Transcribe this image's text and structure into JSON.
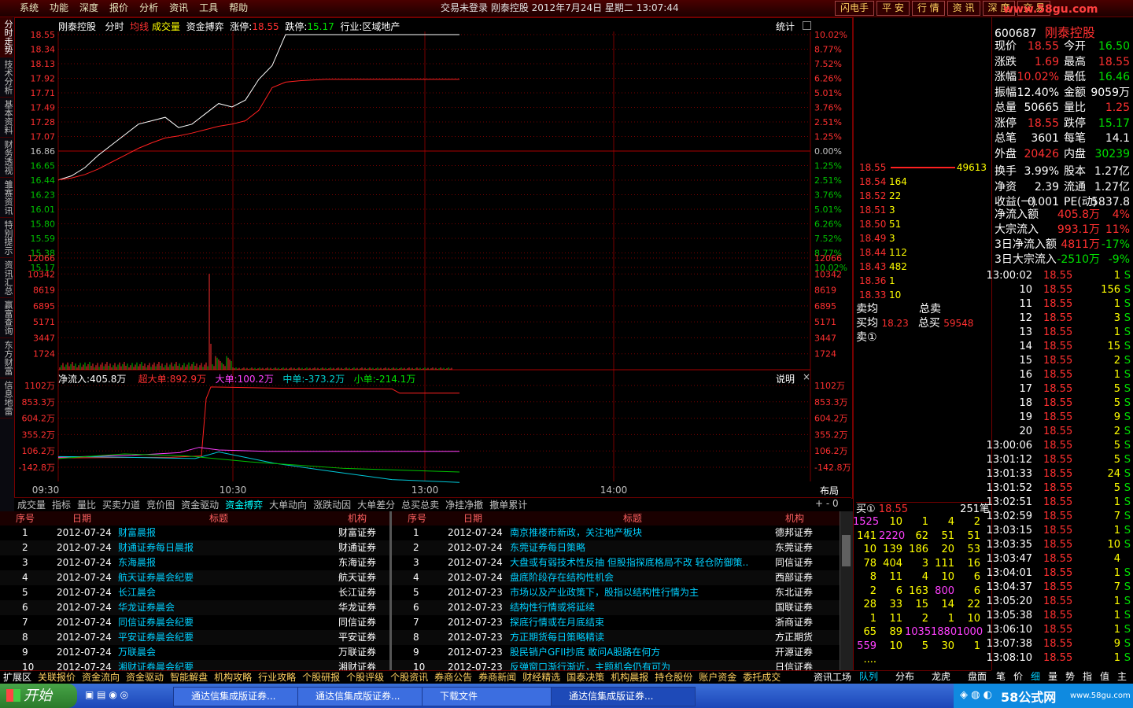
{
  "menu": {
    "items": [
      "系统",
      "功能",
      "深度",
      "报价",
      "分析",
      "资讯",
      "工具",
      "帮助"
    ]
  },
  "window_title": "交易未登录   刚泰控股  2012年7月24日  星期二  13:07:44",
  "top_buttons": [
    "闪电手",
    "平 安",
    "行 情",
    "资 讯",
    "深 度",
    "交 易"
  ],
  "watermark": "www.58gu.com",
  "side_tabs": [
    "分时走势",
    "技术分析",
    "基本资料",
    "财务透视",
    "雏赛资讯",
    "特别提示",
    "资讯汇总",
    "赢富查询",
    "东方财富",
    "信息地雷"
  ],
  "chart_header": {
    "name": "刚泰控股",
    "mode": "分时",
    "avg_label": "均线",
    "vol_label": "成交量",
    "fund_label": "资金搏弈",
    "limit_up_label": "涨停:",
    "limit_up": "18.55",
    "limit_down_label": "跌停:",
    "limit_down": "15.17",
    "industry": "行业:区域地产",
    "stat": "统计"
  },
  "flow_header": {
    "net": "净流入:405.8万",
    "super": "超大单:892.9万",
    "big": "大单:100.2万",
    "mid": "中单:-373.2万",
    "small": "小单:-214.1万",
    "explain": "说明"
  },
  "time_labels": [
    "09:30",
    "10:30",
    "13:00",
    "14:00"
  ],
  "layout_label": "布局",
  "chart_data": [
    {
      "type": "line",
      "title": "",
      "price_ticks": [
        "18.55",
        "18.34",
        "18.13",
        "17.92",
        "17.71",
        "17.49",
        "17.28",
        "17.07",
        "16.86",
        "16.65",
        "16.44",
        "16.23",
        "16.01",
        "15.80",
        "15.59",
        "15.38",
        "15.17"
      ],
      "pct_ticks": [
        "10.02%",
        "8.77%",
        "7.52%",
        "6.26%",
        "5.01%",
        "3.76%",
        "2.51%",
        "1.25%",
        "0.00%",
        "1.25%",
        "2.51%",
        "3.76%",
        "5.01%",
        "6.26%",
        "7.52%",
        "8.77%",
        "10.02%"
      ],
      "ylim": [
        15.17,
        18.55
      ],
      "series": [
        {
          "name": "现价",
          "values": [
            16.44,
            16.5,
            16.62,
            16.8,
            16.95,
            17.1,
            17.25,
            17.3,
            17.35,
            17.2,
            17.25,
            17.4,
            17.55,
            17.5,
            17.6,
            17.9,
            18.1,
            18.55,
            18.55,
            18.55,
            18.55
          ]
        },
        {
          "name": "均价",
          "values": [
            16.44,
            16.47,
            16.52,
            16.6,
            16.7,
            16.8,
            16.9,
            16.98,
            17.05,
            17.08,
            17.12,
            17.17,
            17.22,
            17.25,
            17.3,
            17.45,
            17.78,
            17.86,
            17.88,
            17.89,
            17.9
          ]
        }
      ]
    },
    {
      "type": "bar",
      "title": "",
      "vol_ticks": [
        "12066",
        "10342",
        "8619",
        "6895",
        "5171",
        "3447",
        "1724"
      ],
      "ylim": [
        0,
        12066
      ],
      "peak": 10342
    },
    {
      "type": "line",
      "title": "",
      "flow_ticks": [
        "1102万",
        "853.3万",
        "604.2万",
        "355.2万",
        "106.2万",
        "-142.8万"
      ],
      "ylim": [
        -142.8,
        1102
      ]
    }
  ],
  "bottom_tabs": [
    "成交量",
    "指标",
    "量比",
    "买卖力道",
    "竞价图",
    "资金驱动",
    "资金搏弈",
    "大单动向",
    "涨跌动因",
    "大单差分",
    "总买总卖",
    "净挂净撤",
    "撤单累计"
  ],
  "active_tab": "资金搏弈",
  "grid": {
    "headers_left": [
      "序号",
      "日期",
      "标题",
      "机构"
    ],
    "headers_right": [
      "序号",
      "日期",
      "标题",
      "机构"
    ],
    "left_rows": [
      [
        "1",
        "2012-07-24",
        "财富晨报",
        "财富证券"
      ],
      [
        "2",
        "2012-07-24",
        "财通证券每日晨报",
        "财通证券"
      ],
      [
        "3",
        "2012-07-24",
        "东海晨报",
        "东海证券"
      ],
      [
        "4",
        "2012-07-24",
        "航天证券晨会纪要",
        "航天证券"
      ],
      [
        "5",
        "2012-07-24",
        "长江晨会",
        "长江证券"
      ],
      [
        "6",
        "2012-07-24",
        "华龙证券晨会",
        "华龙证券"
      ],
      [
        "7",
        "2012-07-24",
        "同信证券晨会纪要",
        "同信证券"
      ],
      [
        "8",
        "2012-07-24",
        "平安证券晨会纪要",
        "平安证券"
      ],
      [
        "9",
        "2012-07-24",
        "万联晨会",
        "万联证券"
      ],
      [
        "10",
        "2012-07-24",
        "湘财证券晨会纪要",
        "湘财证券"
      ]
    ],
    "right_rows": [
      [
        "1",
        "2012-07-24",
        "南京推楼市新政，关注地产板块",
        "德邦证券"
      ],
      [
        "2",
        "2012-07-24",
        "东莞证券每日策略",
        "东莞证券"
      ],
      [
        "3",
        "2012-07-24",
        "大盘或有弱技术性反抽 但股指探底格局不改 轻仓防御策..",
        "同信证券"
      ],
      [
        "4",
        "2012-07-24",
        "盘底阶段存在结构性机会",
        "西部证券"
      ],
      [
        "5",
        "2012-07-23",
        "市场以及产业政策下，股指以结构性行情为主",
        "东北证券"
      ],
      [
        "6",
        "2012-07-23",
        "结构性行情或将延续",
        "国联证券"
      ],
      [
        "7",
        "2012-07-23",
        "探底行情或在月底结束",
        "浙商证券"
      ],
      [
        "8",
        "2012-07-23",
        "方正期货每日策略精读",
        "方正期货"
      ],
      [
        "9",
        "2012-07-23",
        "股民销户GFII抄底 敢问A股路在何方",
        "开源证券"
      ],
      [
        "10",
        "2012-07-23",
        "反弹窗口渐行渐近，主题机会仍有可为",
        "日信证券"
      ]
    ]
  },
  "bottom_bar": [
    "扩展区",
    "关联报价",
    "资金流向",
    "资金驱动",
    "智能解盘",
    "机构攻略",
    "行业攻略",
    "个股研报",
    "个股评级",
    "个股资讯",
    "券商公告",
    "券商新闻",
    "财经精选",
    "国泰决策",
    "机构晨报",
    "持仓股份",
    "账户资金",
    "委托成交",
    "资讯工场"
  ],
  "right_bottom_tabs": [
    "队列",
    "分布",
    "龙虎",
    "盘面"
  ],
  "far_right_tabs": [
    "笔",
    "价",
    "细",
    "量",
    "势",
    "指",
    "值",
    "主"
  ],
  "stock": {
    "code": "600687",
    "name": "刚泰控股"
  },
  "quote": [
    [
      "现价",
      "18.55",
      "今开",
      "16.50"
    ],
    [
      "涨跌",
      "1.69",
      "最高",
      "18.55"
    ],
    [
      "涨幅",
      "10.02%",
      "最低",
      "16.46"
    ],
    [
      "振幅",
      "12.40%",
      "金额",
      "9059万"
    ],
    [
      "总量",
      "50665",
      "量比",
      "1.25"
    ],
    [
      "涨停",
      "18.55",
      "跌停",
      "15.17"
    ],
    [
      "总笔",
      "3601",
      "每笔",
      "14.1"
    ],
    [
      "外盘",
      "20426",
      "内盘",
      "30239"
    ],
    [
      "换手",
      "3.99%",
      "股本",
      "1.27亿"
    ],
    [
      "净资",
      "2.39",
      "流通",
      "1.27亿"
    ],
    [
      "收益(一)",
      "0.001",
      "PE(动)",
      "5837.8"
    ]
  ],
  "flow_summary": [
    [
      "净流入额",
      "405.8万",
      "4%"
    ],
    [
      "大宗流入",
      "993.1万",
      "11%"
    ],
    [
      "3日净流入额",
      "4811万",
      "-17%"
    ],
    [
      "3日大宗流入",
      "-2510万",
      "-9%"
    ]
  ],
  "orderbook": {
    "rows": [
      [
        "18.55",
        "49613"
      ],
      [
        "18.54",
        "164"
      ],
      [
        "18.52",
        "22"
      ],
      [
        "18.51",
        "3"
      ],
      [
        "18.50",
        "51"
      ],
      [
        "18.49",
        "3"
      ],
      [
        "18.44",
        "112"
      ],
      [
        "18.43",
        "482"
      ],
      [
        "18.36",
        "1"
      ],
      [
        "18.33",
        "10"
      ]
    ],
    "sell_avg": "卖均",
    "buy_avg": "买均",
    "buy_avg_val": "18.23",
    "total_sell": "总卖",
    "total_buy": "总买",
    "total_buy_val": "59548",
    "sell1": "卖①",
    "buy1_label": "买①",
    "buy1_price": "18.55",
    "buy1_count": "251笔"
  },
  "queue": [
    [
      "1525",
      "10",
      "1",
      "4",
      "2"
    ],
    [
      "141",
      "2220",
      "62",
      "51",
      "51"
    ],
    [
      "10",
      "139",
      "186",
      "20",
      "53"
    ],
    [
      "78",
      "404",
      "3",
      "111",
      "16"
    ],
    [
      "8",
      "11",
      "4",
      "10",
      "6"
    ],
    [
      "2",
      "6",
      "163",
      "800",
      "6"
    ],
    [
      "28",
      "33",
      "15",
      "14",
      "22"
    ],
    [
      "1",
      "11",
      "2",
      "1",
      "10"
    ],
    [
      "65",
      "89",
      "1035",
      "1880",
      "1000"
    ],
    [
      "559",
      "10",
      "5",
      "30",
      "1"
    ],
    [
      "....",
      "",
      "",
      "",
      ""
    ]
  ],
  "ticks": [
    [
      "13:00:02",
      "18.55",
      "1",
      "S"
    ],
    [
      "10",
      "18.55",
      "156",
      "S"
    ],
    [
      "11",
      "18.55",
      "1",
      "S"
    ],
    [
      "12",
      "18.55",
      "3",
      "S"
    ],
    [
      "13",
      "18.55",
      "1",
      "S"
    ],
    [
      "14",
      "18.55",
      "15",
      "S"
    ],
    [
      "15",
      "18.55",
      "2",
      "S"
    ],
    [
      "16",
      "18.55",
      "1",
      "S"
    ],
    [
      "17",
      "18.55",
      "5",
      "S"
    ],
    [
      "18",
      "18.55",
      "5",
      "S"
    ],
    [
      "19",
      "18.55",
      "9",
      "S"
    ],
    [
      "20",
      "18.55",
      "2",
      "S"
    ],
    [
      "13:00:06",
      "18.55",
      "5",
      "S"
    ],
    [
      "13:01:12",
      "18.55",
      "5",
      "S"
    ],
    [
      "13:01:33",
      "18.55",
      "24",
      "S"
    ],
    [
      "13:01:52",
      "18.55",
      "5",
      "S"
    ],
    [
      "13:02:51",
      "18.55",
      "1",
      "S"
    ],
    [
      "13:02:59",
      "18.55",
      "7",
      "S"
    ],
    [
      "13:03:15",
      "18.55",
      "1",
      "S"
    ],
    [
      "13:03:35",
      "18.55",
      "10",
      "S"
    ],
    [
      "13:03:47",
      "18.55",
      "4",
      ""
    ],
    [
      "13:04:01",
      "18.55",
      "1",
      "S"
    ],
    [
      "13:04:37",
      "18.55",
      "7",
      "S"
    ],
    [
      "13:05:20",
      "18.55",
      "1",
      "S"
    ],
    [
      "13:05:38",
      "18.55",
      "1",
      "S"
    ],
    [
      "13:06:10",
      "18.55",
      "1",
      "S"
    ],
    [
      "13:07:38",
      "18.55",
      "9",
      "S"
    ],
    [
      "13:08:10",
      "18.55",
      "1",
      "S"
    ]
  ],
  "taskbar": {
    "start": "开始",
    "tasks": [
      "通达信集成版证券...",
      "通达信集成版证券...",
      "下载文件",
      "通达信集成版证券..."
    ],
    "tray_brand": "58公式网",
    "tray_url": "www.58gu.com"
  }
}
